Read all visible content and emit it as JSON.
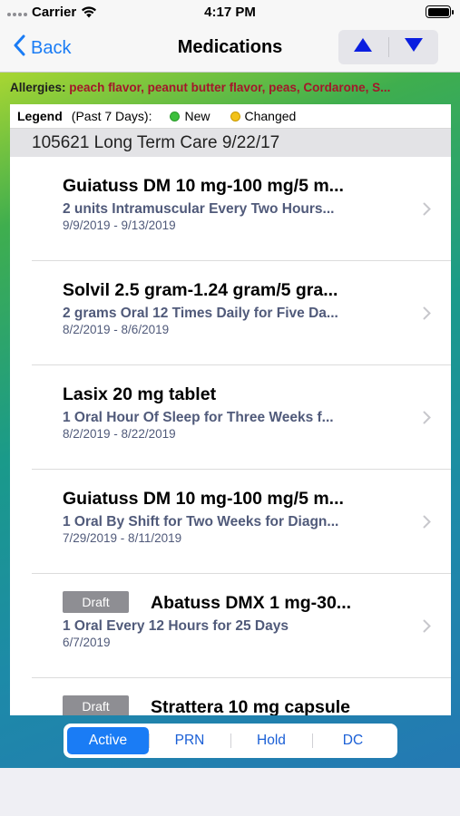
{
  "status_bar": {
    "carrier": "Carrier",
    "time": "4:17 PM"
  },
  "nav": {
    "back_label": "Back",
    "title": "Medications",
    "up_icon": "triangle-up-icon",
    "down_icon": "triangle-down-icon",
    "accent_color": "#1a7cf5"
  },
  "allergies": {
    "label": "Allergies:",
    "value": "peach flavor, peanut butter flavor, peas, Cordarone, S..."
  },
  "legend": {
    "title": "Legend",
    "period": "(Past 7 Days):",
    "new_label": "New",
    "changed_label": "Changed"
  },
  "section": {
    "header": "105621 Long Term Care 9/22/17"
  },
  "medications": [
    {
      "name": "Guiatuss DM 10 mg-100 mg/5 m...",
      "sig": "2 units Intramuscular Every Two Hours...",
      "dates": "9/9/2019 - 9/13/2019",
      "draft": ""
    },
    {
      "name": "Solvil 2.5 gram-1.24 gram/5 gra...",
      "sig": "2 grams Oral 12 Times Daily for Five Da...",
      "dates": "8/2/2019 - 8/6/2019",
      "draft": ""
    },
    {
      "name": "Lasix 20 mg tablet",
      "sig": "1 Oral Hour Of Sleep for Three Weeks f...",
      "dates": "8/2/2019 - 8/22/2019",
      "draft": ""
    },
    {
      "name": "Guiatuss DM 10 mg-100 mg/5 m...",
      "sig": "1 Oral By Shift for Two Weeks for Diagn...",
      "dates": "7/29/2019 - 8/11/2019",
      "draft": ""
    },
    {
      "name": "Abatuss DMX 1 mg-30...",
      "sig": "1 Oral Every 12 Hours for 25 Days",
      "dates": "6/7/2019",
      "draft": "Draft"
    },
    {
      "name": "Strattera 10 mg capsule",
      "sig": "",
      "dates": "",
      "draft": "Draft"
    }
  ],
  "segments": {
    "items": [
      "Active",
      "PRN",
      "Hold",
      "DC"
    ],
    "selected": "Active"
  }
}
